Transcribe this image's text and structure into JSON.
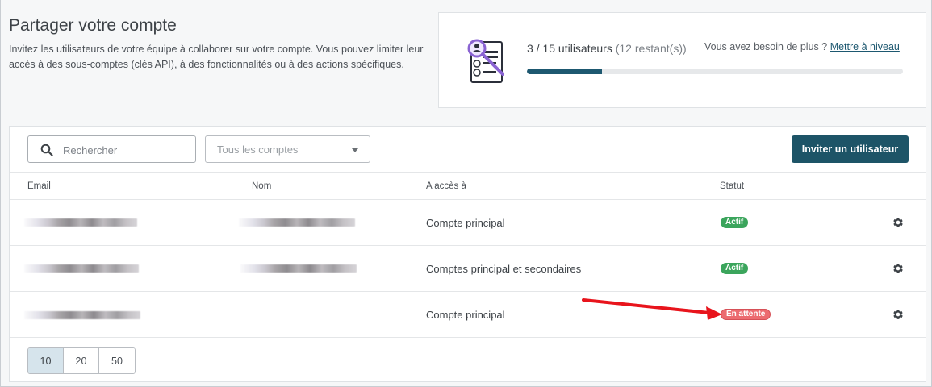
{
  "header": {
    "title": "Partager votre compte",
    "description": "Invitez les utilisateurs de votre équipe à collaborer sur votre compte. Vous pouvez limiter leur accès à des sous-comptes (clés API), à des fonctionnalités ou à des actions spécifiques."
  },
  "usage": {
    "illustration": "user-document-search-icon",
    "count": "3 / 15 utilisateurs",
    "remaining": "(12 restant(s))",
    "more_prompt": "Vous avez besoin de plus ?",
    "upgrade_link": "Mettre à niveau",
    "progress": 0.2,
    "progress_color": "#1d5870"
  },
  "toolbar": {
    "search_placeholder": "Rechercher",
    "search_value": "",
    "account_filter": "Tous les comptes",
    "invite_button": "Inviter un utilisateur",
    "invite_color": "#1d5467"
  },
  "table": {
    "columns": [
      "Email",
      "Nom",
      "A accès à",
      "Statut"
    ],
    "rows": [
      {
        "access": "Compte principal",
        "status": "Actif",
        "status_color": "#3ba55c"
      },
      {
        "access": "Comptes principal et secondaires",
        "status": "Actif",
        "status_color": "#3ba55c"
      },
      {
        "access": "Compte principal",
        "status": "En attente",
        "status_color": "#ec6b70"
      }
    ]
  },
  "pagination": {
    "sizes": [
      "10",
      "20",
      "50"
    ],
    "selected": "10"
  },
  "annotation": {
    "arrow_color": "#e8141c"
  }
}
